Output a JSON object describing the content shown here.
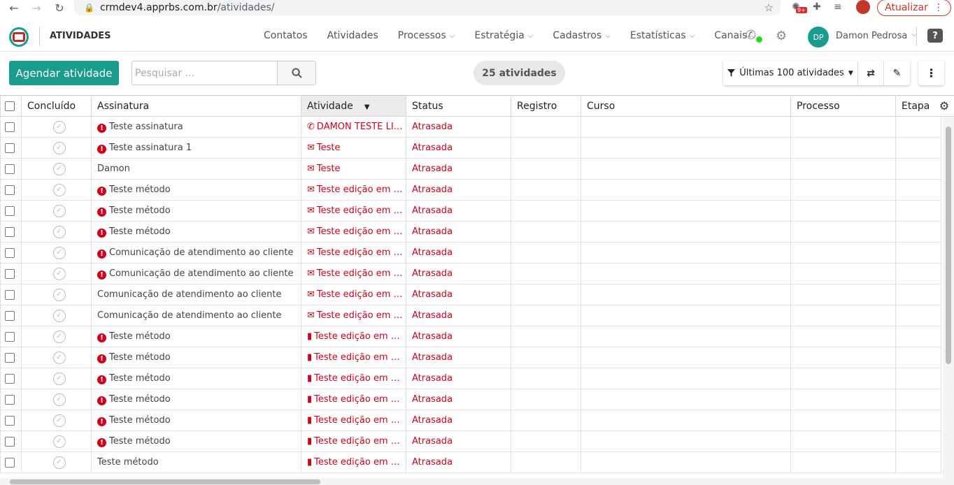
{
  "browser": {
    "url_host": "crmdev4.apprbs.com.br",
    "url_path": "/atividades/",
    "update_label": "Atualizar",
    "ext_badge": "9+"
  },
  "header": {
    "title": "ATIVIDADES",
    "nav": [
      {
        "label": "Contatos",
        "dropdown": false
      },
      {
        "label": "Atividades",
        "dropdown": false
      },
      {
        "label": "Processos",
        "dropdown": true
      },
      {
        "label": "Estratégia",
        "dropdown": true
      },
      {
        "label": "Cadastros",
        "dropdown": true
      },
      {
        "label": "Estatísticas",
        "dropdown": true
      },
      {
        "label": "Canais",
        "dropdown": true
      }
    ],
    "user_initials": "DP",
    "user_name": "Damon Pedrosa",
    "help_label": "?"
  },
  "toolbar": {
    "schedule_label": "Agendar atividade",
    "search_placeholder": "Pesquisar ...",
    "count_label": "25 atividades",
    "filter_label": "Últimas 100 atividades"
  },
  "table": {
    "columns": [
      "Concluído",
      "Assinatura",
      "Atividade",
      "Status",
      "Registro",
      "Curso",
      "Processo",
      "Etapa"
    ],
    "rows": [
      {
        "alert": true,
        "assinatura": "Teste assinatura",
        "icon": "phone",
        "atividade": "DAMON TESTE LIGAÇÃO",
        "status": "Atrasada"
      },
      {
        "alert": true,
        "assinatura": "Teste assinatura 1",
        "icon": "mail",
        "atividade": "Teste",
        "status": "Atrasada"
      },
      {
        "alert": false,
        "assinatura": "Damon",
        "icon": "mail",
        "atividade": "Teste",
        "status": "Atrasada"
      },
      {
        "alert": true,
        "assinatura": "Teste método",
        "icon": "mail",
        "atividade": "Teste edição em massa",
        "status": "Atrasada"
      },
      {
        "alert": true,
        "assinatura": "Teste método",
        "icon": "mail",
        "atividade": "Teste edição em massa",
        "status": "Atrasada"
      },
      {
        "alert": true,
        "assinatura": "Teste método",
        "icon": "mail",
        "atividade": "Teste edição em massa",
        "status": "Atrasada"
      },
      {
        "alert": true,
        "assinatura": "Comunicação de atendimento ao cliente",
        "icon": "mail",
        "atividade": "Teste edição em massa",
        "status": "Atrasada"
      },
      {
        "alert": true,
        "assinatura": "Comunicação de atendimento ao cliente",
        "icon": "mail",
        "atividade": "Teste edição em massa",
        "status": "Atrasada"
      },
      {
        "alert": false,
        "assinatura": "Comunicação de atendimento ao cliente",
        "icon": "mail",
        "atividade": "Teste edição em massa",
        "status": "Atrasada"
      },
      {
        "alert": false,
        "assinatura": "Comunicação de atendimento ao cliente",
        "icon": "mail",
        "atividade": "Teste edição em massa",
        "status": "Atrasada"
      },
      {
        "alert": true,
        "assinatura": "Teste método",
        "icon": "task",
        "atividade": "Teste edição em massa",
        "status": "Atrasada"
      },
      {
        "alert": true,
        "assinatura": "Teste método",
        "icon": "task",
        "atividade": "Teste edição em massa",
        "status": "Atrasada"
      },
      {
        "alert": true,
        "assinatura": "Teste método",
        "icon": "task",
        "atividade": "Teste edição em massa",
        "status": "Atrasada"
      },
      {
        "alert": true,
        "assinatura": "Teste método",
        "icon": "task",
        "atividade": "Teste edição em massa",
        "status": "Atrasada"
      },
      {
        "alert": true,
        "assinatura": "Teste método",
        "icon": "task",
        "atividade": "Teste edição em massa",
        "status": "Atrasada"
      },
      {
        "alert": true,
        "assinatura": "Teste método",
        "icon": "task",
        "atividade": "Teste edição em massa",
        "status": "Atrasada"
      },
      {
        "alert": false,
        "assinatura": "Teste método",
        "icon": "task",
        "atividade": "Teste edição em massa",
        "status": "Atrasada"
      }
    ]
  },
  "colors": {
    "brand": "#1a9c8c",
    "alert": "#d0021b"
  }
}
